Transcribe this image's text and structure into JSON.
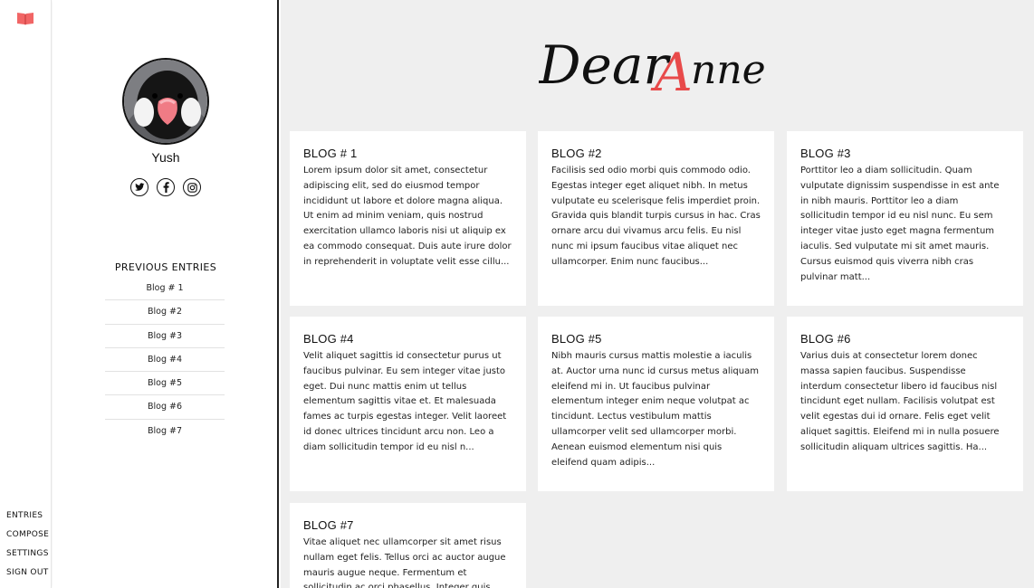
{
  "rail": {
    "nav": [
      "ENTRIES",
      "COMPOSE",
      "SETTINGS",
      "SIGN OUT"
    ],
    "accent": "#f16565"
  },
  "profile": {
    "username": "Yush",
    "socials": [
      "twitter-icon",
      "facebook-icon",
      "instagram-icon"
    ],
    "previous_title": "PREVIOUS ENTRIES",
    "previous_entries": [
      "Blog # 1",
      "Blog #2",
      "Blog #3",
      "Blog #4",
      "Blog #5",
      "Blog #6",
      "Blog #7"
    ]
  },
  "brand": {
    "part1": "Dear",
    "accent_letter": "A",
    "part2": "nne",
    "accent_color": "#e84a4a"
  },
  "blogs": [
    {
      "title": "BLOG # 1",
      "excerpt": "Lorem ipsum dolor sit amet, consectetur adipiscing elit, sed do eiusmod tempor incididunt ut labore et dolore magna aliqua. Ut enim ad minim veniam, quis nostrud exercitation ullamco laboris nisi ut aliquip ex ea commodo consequat. Duis aute irure dolor in reprehenderit in voluptate velit esse cillu..."
    },
    {
      "title": "BLOG #2",
      "excerpt": "Facilisis sed odio morbi quis commodo odio. Egestas integer eget aliquet nibh. In metus vulputate eu scelerisque felis imperdiet proin. Gravida quis blandit turpis cursus in hac. Cras ornare arcu dui vivamus arcu felis. Eu nisl nunc mi ipsum faucibus vitae aliquet nec ullamcorper. Enim nunc faucibus..."
    },
    {
      "title": "BLOG #3",
      "excerpt": "Porttitor leo a diam sollicitudin. Quam vulputate dignissim suspendisse in est ante in nibh mauris. Porttitor leo a diam sollicitudin tempor id eu nisl nunc. Eu sem integer vitae justo eget magna fermentum iaculis. Sed vulputate mi sit amet mauris. Cursus euismod quis viverra nibh cras pulvinar matt..."
    },
    {
      "title": "BLOG #4",
      "excerpt": "Velit aliquet sagittis id consectetur purus ut faucibus pulvinar. Eu sem integer vitae justo eget. Dui nunc mattis enim ut tellus elementum sagittis vitae et. Et malesuada fames ac turpis egestas integer. Velit laoreet id donec ultrices tincidunt arcu non. Leo a diam sollicitudin tempor id eu nisl n..."
    },
    {
      "title": "BLOG #5",
      "excerpt": "Nibh mauris cursus mattis molestie a iaculis at. Auctor urna nunc id cursus metus aliquam eleifend mi in. Ut faucibus pulvinar elementum integer enim neque volutpat ac tincidunt. Lectus vestibulum mattis ullamcorper velit sed ullamcorper morbi. Aenean euismod elementum nisi quis eleifend quam adipis..."
    },
    {
      "title": "BLOG #6",
      "excerpt": "Varius duis at consectetur lorem donec massa sapien faucibus. Suspendisse interdum consectetur libero id faucibus nisl tincidunt eget nullam. Facilisis volutpat est velit egestas dui id ornare. Felis eget velit aliquet sagittis. Eleifend mi in nulla posuere sollicitudin aliquam ultrices sagittis. Ha..."
    },
    {
      "title": "BLOG #7",
      "excerpt": "Vitae aliquet nec ullamcorper sit amet risus nullam eget felis. Tellus orci ac auctor augue mauris augue neque. Fermentum et sollicitudin ac orci phasellus. Integer quis auctor elit sed vulputate mi sit amet."
    }
  ]
}
